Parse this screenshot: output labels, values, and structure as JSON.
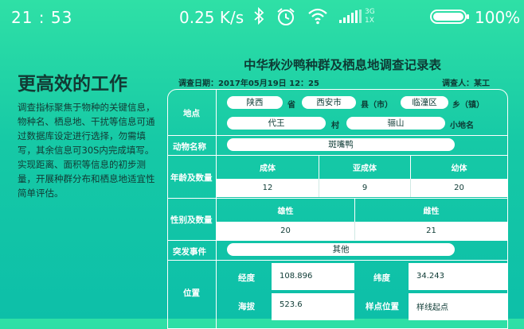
{
  "status": {
    "time": "21 : 53",
    "speed": "0.25 K/s",
    "network_top": "3G",
    "network_bottom": "1X",
    "battery": "100%",
    "icons": [
      "bluetooth-icon",
      "alarm-icon",
      "wifi-icon",
      "signal-icon",
      "battery-icon"
    ]
  },
  "left": {
    "title": "更高效的工作",
    "paragraphs": [
      "调查指标聚焦于物种的关键信息，物种名、栖息地、干扰等信息可通过数据库设定进行选择，勿需填写，其余信息可30S内完成填写。",
      "实现距离、面积等信息的初步测量，开展种群分布和栖息地适宜性简单评估。"
    ]
  },
  "form": {
    "title": "中华秋沙鸭种群及栖息地调查记录表",
    "date": "调查日期：2017年05月19日 12：25",
    "surveyor": "调查人：某工",
    "location": {
      "label": "地点",
      "province": "陕西",
      "province_unit": "省",
      "city": "西安市",
      "city_unit": "县（市）",
      "district": "临潼区",
      "district_unit": "乡（镇）",
      "village": "代王",
      "village_unit": "村",
      "place": "骊山",
      "place_unit": "小地名"
    },
    "animal": {
      "label": "动物名称",
      "value": "斑嘴鸭"
    },
    "age": {
      "label": "年龄及数量",
      "headers": [
        "成体",
        "亚成体",
        "幼体"
      ],
      "values": [
        "12",
        "9",
        "20"
      ]
    },
    "sex": {
      "label": "性别及数量",
      "headers": [
        "雄性",
        "雌性"
      ],
      "values": [
        "20",
        "21"
      ]
    },
    "event": {
      "label": "突发事件",
      "value": "其他"
    },
    "position": {
      "label": "位置",
      "longitude_label": "经度",
      "longitude": "108.896",
      "latitude_label": "纬度",
      "latitude": "34.243",
      "altitude_label": "海拔",
      "altitude": "523.6",
      "sample_label": "样点位置",
      "sample": "样线起点"
    }
  }
}
